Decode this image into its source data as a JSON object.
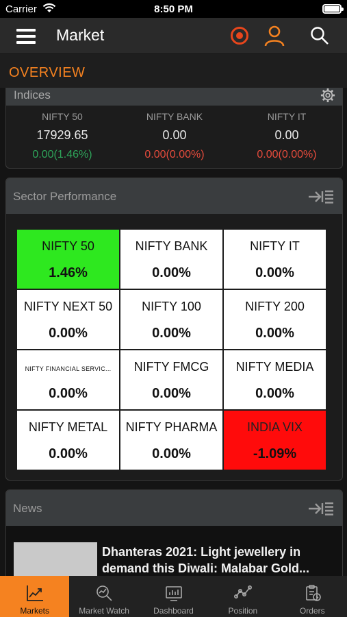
{
  "status_bar": {
    "carrier": "Carrier",
    "time": "8:50 PM"
  },
  "header": {
    "title": "Market"
  },
  "overview": {
    "title": "OVERVIEW"
  },
  "indices": {
    "label": "Indices",
    "items": [
      {
        "name": "NIFTY 50",
        "value": "17929.65",
        "change": "0.00(1.46%)",
        "direction": "up"
      },
      {
        "name": "NIFTY BANK",
        "value": "0.00",
        "change": "0.00(0.00%)",
        "direction": "down"
      },
      {
        "name": "NIFTY IT",
        "value": "0.00",
        "change": "0.00(0.00%)",
        "direction": "down"
      }
    ]
  },
  "sector": {
    "label": "Sector Performance",
    "tiles": [
      {
        "name": "NIFTY 50",
        "value": "1.46%",
        "state": "up"
      },
      {
        "name": "NIFTY BANK",
        "value": "0.00%",
        "state": "neutral"
      },
      {
        "name": "NIFTY IT",
        "value": "0.00%",
        "state": "neutral"
      },
      {
        "name": "NIFTY NEXT 50",
        "value": "0.00%",
        "state": "neutral"
      },
      {
        "name": "NIFTY 100",
        "value": "0.00%",
        "state": "neutral"
      },
      {
        "name": "NIFTY 200",
        "value": "0.00%",
        "state": "neutral"
      },
      {
        "name": "NIFTY FINANCIAL SERVIC...",
        "value": "0.00%",
        "state": "neutral",
        "small": true
      },
      {
        "name": "NIFTY FMCG",
        "value": "0.00%",
        "state": "neutral"
      },
      {
        "name": "NIFTY MEDIA",
        "value": "0.00%",
        "state": "neutral"
      },
      {
        "name": "NIFTY METAL",
        "value": "0.00%",
        "state": "neutral"
      },
      {
        "name": "NIFTY PHARMA",
        "value": "0.00%",
        "state": "neutral"
      },
      {
        "name": "INDIA VIX",
        "value": "-1.09%",
        "state": "down"
      }
    ]
  },
  "news": {
    "label": "News",
    "items": [
      {
        "line1": "Dhanteras 2021: Light jewellery in",
        "line2": "demand this Diwali: Malabar Gold..."
      }
    ]
  },
  "tabs": [
    {
      "label": "Markets",
      "icon": "trend-chart-icon",
      "active": true
    },
    {
      "label": "Market Watch",
      "icon": "watch-search-icon",
      "active": false
    },
    {
      "label": "Dashboard",
      "icon": "dashboard-icon",
      "active": false
    },
    {
      "label": "Position",
      "icon": "position-icon",
      "active": false
    },
    {
      "label": "Orders",
      "icon": "orders-icon",
      "active": false
    }
  ],
  "colors": {
    "accent": "#f58220",
    "up": "#2ee81f",
    "down": "#ff0b0b",
    "record": "#e8461c"
  }
}
